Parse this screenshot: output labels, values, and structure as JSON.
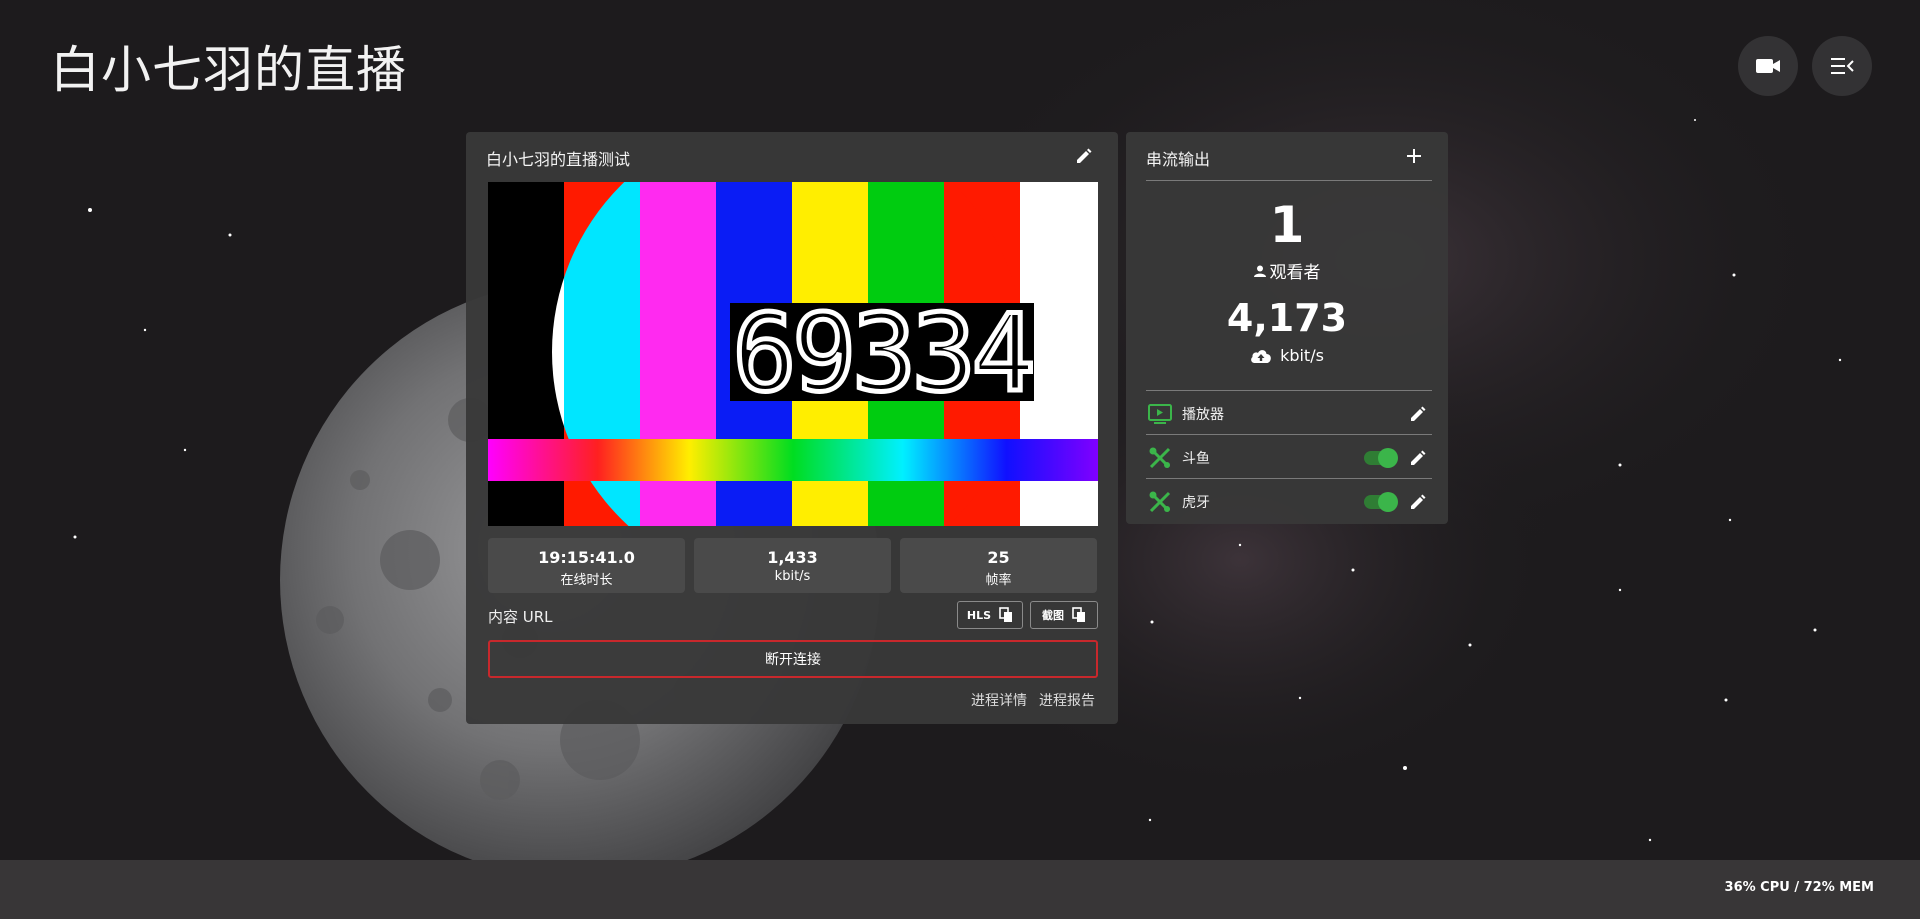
{
  "header": {
    "title": "白小七羽的直播"
  },
  "icons": {
    "camera": "camera-icon",
    "menu": "menu-collapse-icon",
    "edit": "pencil-icon",
    "add": "plus-icon",
    "viewers": "person-icon",
    "bandwidth": "cloud-upload-icon",
    "player": "player-icon",
    "egress": "tools-icon",
    "copy": "copy-icon"
  },
  "stream": {
    "title": "白小七羽的直播测试",
    "test_pattern_counter": "69334",
    "stats": [
      {
        "value": "19:15:41.0",
        "label": "在线时长"
      },
      {
        "value": "1,433",
        "label": "kbit/s"
      },
      {
        "value": "25",
        "label": "帧率"
      }
    ],
    "content_url_label": "内容 URL",
    "hls_label": "HLS",
    "snapshot_label": "截图",
    "disconnect_label": "断开连接",
    "process_details_label": "进程详情",
    "process_report_label": "进程报告"
  },
  "egress": {
    "title": "串流输出",
    "viewers_count": "1",
    "viewers_label": "观看者",
    "bandwidth_value": "4,173",
    "bandwidth_unit": "kbit/s",
    "outputs": [
      {
        "name": "播放器",
        "toggle": null
      },
      {
        "name": "斗鱼",
        "toggle": true
      },
      {
        "name": "虎牙",
        "toggle": true
      }
    ]
  },
  "system": {
    "usage": "36% CPU / 72% MEM"
  },
  "colors": {
    "accent_green": "#3bb54a",
    "danger_red": "#c8282c",
    "card_bg": "#383838"
  }
}
